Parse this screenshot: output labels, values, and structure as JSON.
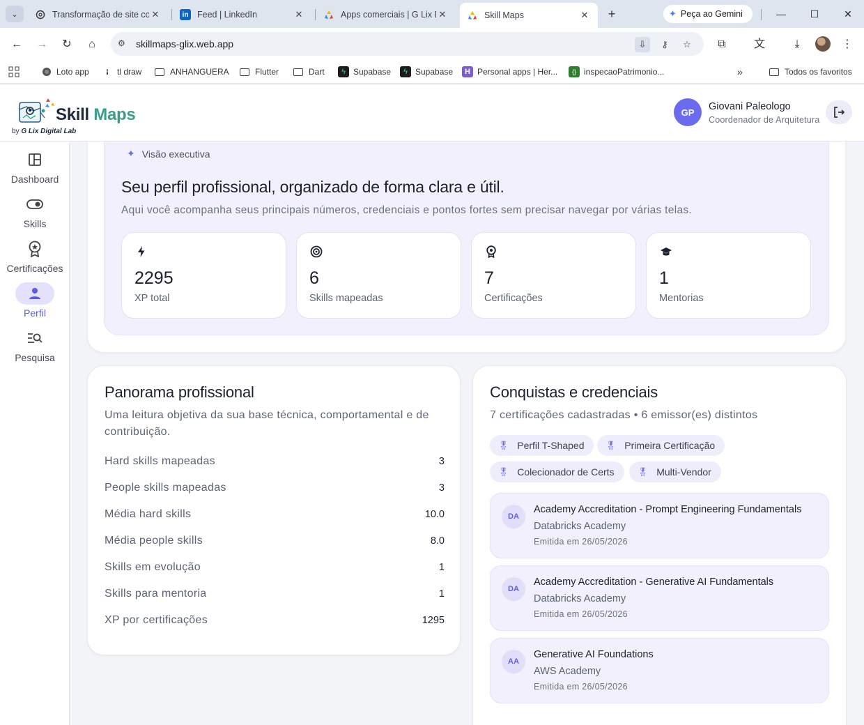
{
  "browser": {
    "tabs": [
      {
        "title": "Transformação de site co",
        "icon": "openai-icon"
      },
      {
        "title": "Feed | LinkedIn",
        "icon": "linkedin-icon"
      },
      {
        "title": "Apps comerciais | G Lix D",
        "icon": "glix-icon"
      },
      {
        "title": "Skill Maps",
        "icon": "glix-icon",
        "active": true
      }
    ],
    "gemini_label": "Peça ao Gemini",
    "url": "skillmaps-glix.web.app",
    "bookmarks": [
      {
        "label": "Loto app",
        "icon": "globe-icon"
      },
      {
        "label": "tl draw",
        "icon": "dots-icon"
      },
      {
        "label": "ANHANGUERA",
        "icon": "folder-icon"
      },
      {
        "label": "Flutter",
        "icon": "folder-icon"
      },
      {
        "label": "Dart",
        "icon": "folder-icon"
      },
      {
        "label": "Supabase",
        "icon": "supabase-icon"
      },
      {
        "label": "Supabase",
        "icon": "supabase-icon"
      },
      {
        "label": "Personal apps | Her...",
        "icon": "heroku-icon"
      },
      {
        "label": "inspecaoPatrimonio...",
        "icon": "code-icon"
      }
    ],
    "all_bookmarks_label": "Todos os favoritos"
  },
  "app": {
    "logo": {
      "part1": "Skill",
      "part2": "Maps",
      "byline_prefix": "by",
      "byline_brand": "G Lix Digital Lab"
    },
    "user": {
      "initials": "GP",
      "name": "Giovani Paleologo",
      "role": "Coordenador de Arquitetura"
    },
    "nav": [
      {
        "label": "Dashboard",
        "icon": "dashboard-icon"
      },
      {
        "label": "Skills",
        "icon": "toggle-icon"
      },
      {
        "label": "Certificações",
        "icon": "award-icon"
      },
      {
        "label": "Perfil",
        "icon": "person-icon",
        "active": true
      },
      {
        "label": "Pesquisa",
        "icon": "search-list-icon"
      }
    ]
  },
  "hero": {
    "chip": "Visão executiva",
    "title": "Seu perfil profissional, organizado de forma clara e útil.",
    "subtitle": "Aqui você acompanha seus principais números, credenciais e pontos fortes sem precisar navegar por várias telas.",
    "stats": [
      {
        "value": "2295",
        "label": "XP total",
        "icon": "bolt-icon"
      },
      {
        "value": "6",
        "label": "Skills mapeadas",
        "icon": "target-icon"
      },
      {
        "value": "7",
        "label": "Certificações",
        "icon": "award-icon"
      },
      {
        "value": "1",
        "label": "Mentorias",
        "icon": "school-icon"
      }
    ]
  },
  "panorama": {
    "title": "Panorama profissional",
    "subtitle_line1": "Uma leitura objetiva da sua base técnica, comportamental e de",
    "subtitle_line2": "contribuição.",
    "rows": [
      {
        "label": "Hard skills mapeadas",
        "value": "3"
      },
      {
        "label": "People skills mapeadas",
        "value": "3"
      },
      {
        "label": "Média hard skills",
        "value": "10.0"
      },
      {
        "label": "Média people skills",
        "value": "8.0"
      },
      {
        "label": "Skills em evolução",
        "value": "1"
      },
      {
        "label": "Skills para mentoria",
        "value": "1"
      },
      {
        "label": "XP por certificações",
        "value": "1295"
      }
    ]
  },
  "conquistas": {
    "title": "Conquistas e credenciais",
    "subtitle": "7 certificações cadastradas • 6 emissor(es) distintos",
    "badges": [
      "Perfil T-Shaped",
      "Primeira Certificação",
      "Colecionador de Certs",
      "Multi-Vendor"
    ],
    "certs": [
      {
        "initials": "DA",
        "title": "Academy Accreditation - Prompt Engineering Fundamentals",
        "issuer": "Databricks Academy",
        "date": "Emitida em 26/05/2026"
      },
      {
        "initials": "DA",
        "title": "Academy Accreditation - Generative AI Fundamentals",
        "issuer": "Databricks Academy",
        "date": "Emitida em 26/05/2026"
      },
      {
        "initials": "AA",
        "title": "Generative AI Foundations",
        "issuer": "AWS Academy",
        "date": "Emitida em 26/05/2026"
      }
    ]
  },
  "colors": {
    "accent": "#6b6bf0",
    "accent_soft": "#f1f0fc",
    "teal": "#3a9c8a"
  }
}
